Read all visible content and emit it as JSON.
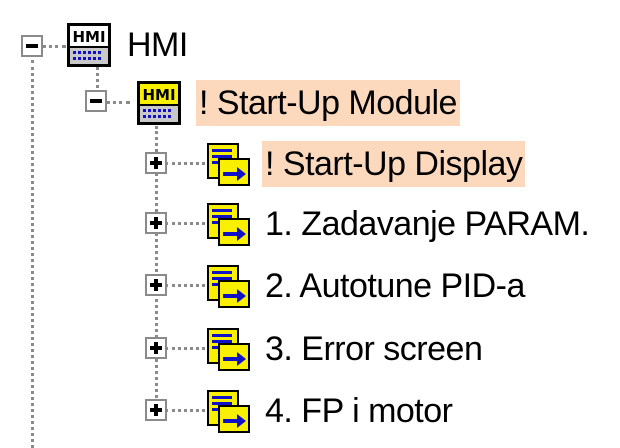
{
  "tree": {
    "root": {
      "label": "HMI",
      "icon": "hmi-module-icon",
      "expanded": true
    },
    "module": {
      "label": "! Start-Up Module",
      "icon": "hmi-module-icon",
      "expanded": true,
      "selected": true
    },
    "displays": [
      {
        "label": "! Start-Up Display",
        "icon": "display-screen-icon",
        "expanded": false,
        "selected": true
      },
      {
        "label": "1. Zadavanje PARAM.",
        "icon": "display-screen-icon",
        "expanded": false,
        "selected": false
      },
      {
        "label": "2. Autotune PID-a",
        "icon": "display-screen-icon",
        "expanded": false,
        "selected": false
      },
      {
        "label": "3. Error screen",
        "icon": "display-screen-icon",
        "expanded": false,
        "selected": false
      },
      {
        "label": "4. FP i motor",
        "icon": "display-screen-icon",
        "expanded": false,
        "selected": false
      }
    ],
    "icon_text": "HMI"
  },
  "colors": {
    "selection": "#fcd9bd",
    "guide": "#8a8a8a",
    "icon_yellow": "#f8f000",
    "icon_blue": "#1010c8"
  }
}
